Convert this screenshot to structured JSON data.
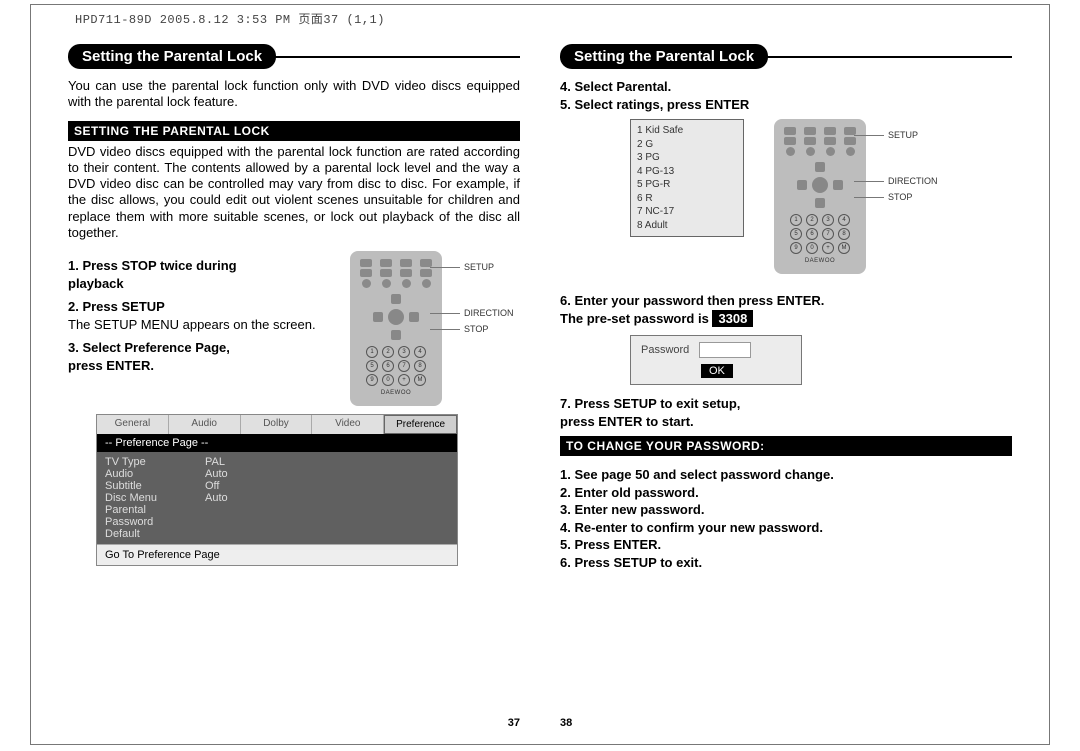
{
  "doc_header": "HPD711-89D  2005.8.12 3:53 PM  页面37 (1,1)",
  "left": {
    "heading": "Setting the Parental Lock",
    "intro": "You can use the parental lock function only with DVD video discs equipped with the parental lock feature.",
    "bar1": "SETTING THE PARENTAL LOCK",
    "para": "DVD video discs equipped with the parental lock function are rated according to their content. The contents allowed by a parental lock level and the way a DVD video disc can be controlled may vary from disc to disc.  For example, if the disc allows, you could edit out violent scenes unsuitable for children and replace them with more suitable scenes, or lock out playback of the disc all together.",
    "step1a": "1. Press STOP twice during",
    "step1b": "playback",
    "step2": "2. Press SETUP",
    "step2sub": "The SETUP MENU appears on the screen.",
    "step3a": "3. Select Preference Page,",
    "step3b": "press ENTER.",
    "remote": {
      "label_setup": "SETUP",
      "label_direction": "DIRECTION",
      "label_stop": "STOP"
    },
    "menu": {
      "tabs": [
        "General",
        "Audio",
        "Dolby",
        "Video",
        "Preference"
      ],
      "title": "-- Preference Page --",
      "rows": [
        {
          "k": "TV Type",
          "v": "PAL"
        },
        {
          "k": "Audio",
          "v": "Auto"
        },
        {
          "k": "Subtitle",
          "v": "Off"
        },
        {
          "k": "Disc Menu",
          "v": "Auto"
        },
        {
          "k": "Parental",
          "v": ""
        },
        {
          "k": "Password",
          "v": ""
        },
        {
          "k": "Default",
          "v": ""
        }
      ],
      "footer": "Go To Preference Page"
    },
    "page": "37"
  },
  "right": {
    "heading": "Setting the Parental Lock",
    "step4": "4. Select Parental.",
    "step5": "5. Select ratings, press ENTER",
    "ratings": [
      "1  Kid Safe",
      "2  G",
      "3  PG",
      "4  PG-13",
      "5  PG-R",
      "6  R",
      "7  NC-17",
      "8  Adult"
    ],
    "remote": {
      "label_setup": "SETUP",
      "label_direction": "DIRECTION",
      "label_stop": "STOP"
    },
    "step6": "6.  Enter your password then press ENTER.",
    "step6b_pre": "The pre-set password is ",
    "step6b_code": "3308",
    "pw_label": "Password",
    "pw_ok": "OK",
    "step7a": "7. Press SETUP to exit setup,",
    "step7b": "press ENTER  to start.",
    "bar2": "TO CHANGE YOUR PASSWORD:",
    "cp1": "1. See page 50 and select password change.",
    "cp2": "2. Enter old password.",
    "cp3": "3. Enter new password.",
    "cp4": "4. Re-enter to confirm your new password.",
    "cp5": "5. Press ENTER.",
    "cp6": "6. Press SETUP to exit.",
    "page": "38"
  }
}
